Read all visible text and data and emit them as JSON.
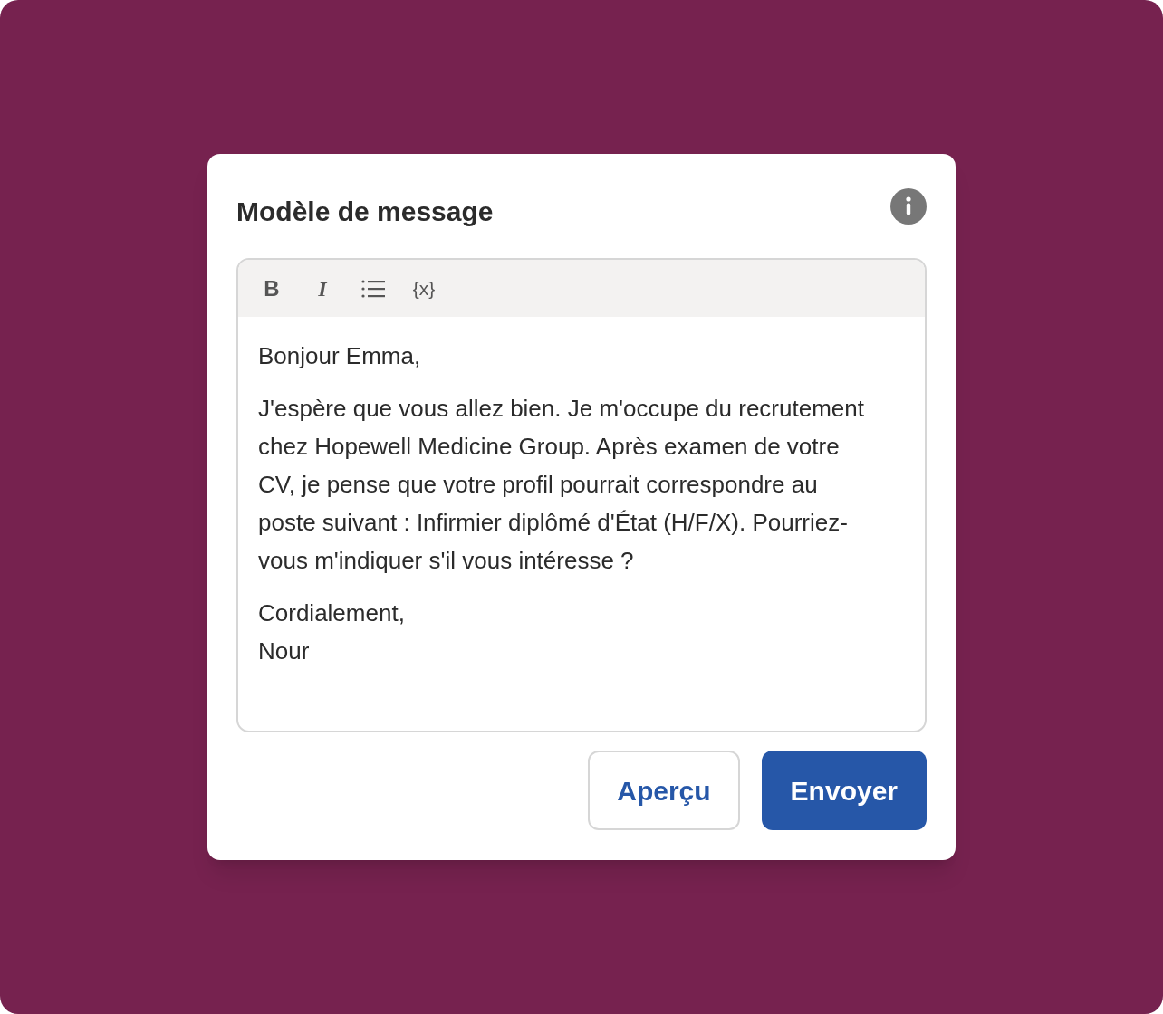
{
  "dialog": {
    "title": "Modèle de message",
    "toolbar": [
      {
        "kind": "bold",
        "label": "B"
      },
      {
        "kind": "italic",
        "label": "I"
      },
      {
        "kind": "list"
      },
      {
        "kind": "variable",
        "label": "{x}"
      }
    ],
    "body": [
      {
        "kind": "paragraph",
        "text": "Bonjour Emma,"
      },
      {
        "kind": "paragraph",
        "text": "J'espère que vous allez bien. Je m'occupe du recrutement chez Hopewell Medicine Group. Après examen de votre CV, je pense que votre profil pourrait correspondre au poste suivant : Infirmier diplômé d'État (H/F/X). Pourriez-vous m'indiquer s'il vous intéresse ?"
      },
      {
        "kind": "closing",
        "text": "Cordialement,"
      },
      {
        "kind": "signature",
        "text": "Nour"
      }
    ],
    "buttons": [
      {
        "kind": "secondary",
        "label": "Aperçu"
      },
      {
        "kind": "primary",
        "label": "Envoyer"
      }
    ]
  }
}
